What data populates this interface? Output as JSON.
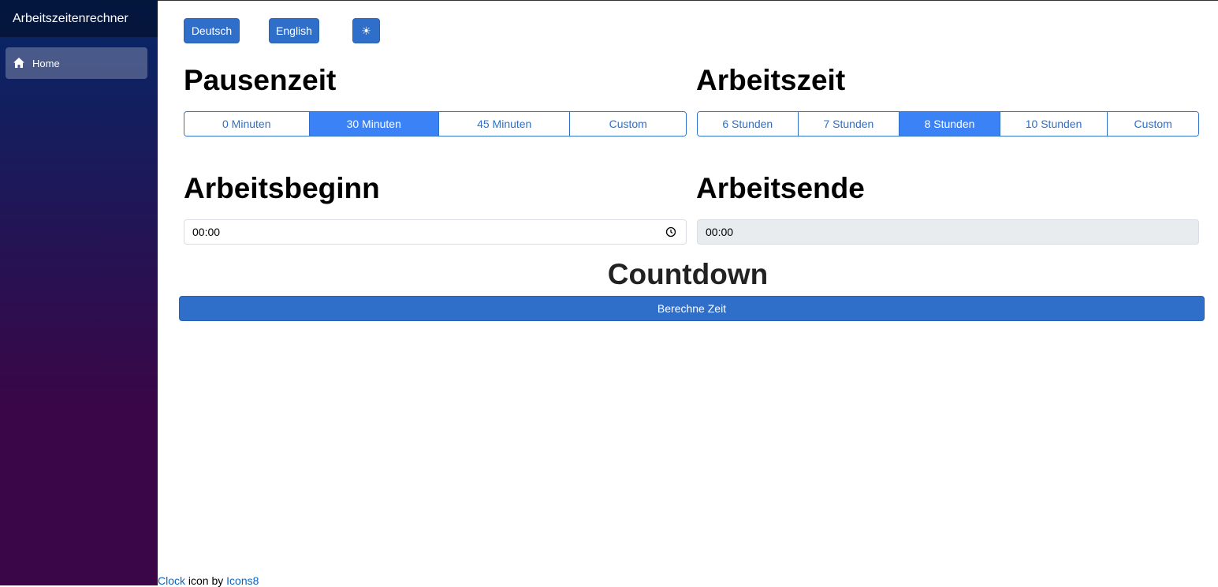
{
  "sidebar": {
    "brand": "Arbeitszeitenrechner",
    "items": [
      {
        "label": "Home",
        "icon": "home-icon"
      }
    ]
  },
  "toolbar": {
    "lang_de": "Deutsch",
    "lang_en": "English",
    "theme_icon": "☀"
  },
  "pause": {
    "title": "Pausenzeit",
    "options": [
      "0 Minuten",
      "30 Minuten",
      "45 Minuten",
      "Custom"
    ],
    "selected": "30 Minuten"
  },
  "work": {
    "title": "Arbeitszeit",
    "options": [
      "6 Stunden",
      "7 Stunden",
      "8 Stunden",
      "10 Stunden",
      "Custom"
    ],
    "selected": "8 Stunden"
  },
  "start": {
    "title": "Arbeitsbeginn",
    "value": "00:00"
  },
  "end": {
    "title": "Arbeitsende",
    "value": "00:00"
  },
  "countdown": {
    "title": "Countdown",
    "button": "Berechne Zeit"
  },
  "footer": {
    "link1": "Clock",
    "text1": " icon by ",
    "link2": "Icons8"
  },
  "colors": {
    "accent": "#2f6fc9",
    "active": "#3b82f6",
    "sidebar_top": "#052767",
    "sidebar_bottom": "#3a0647"
  }
}
